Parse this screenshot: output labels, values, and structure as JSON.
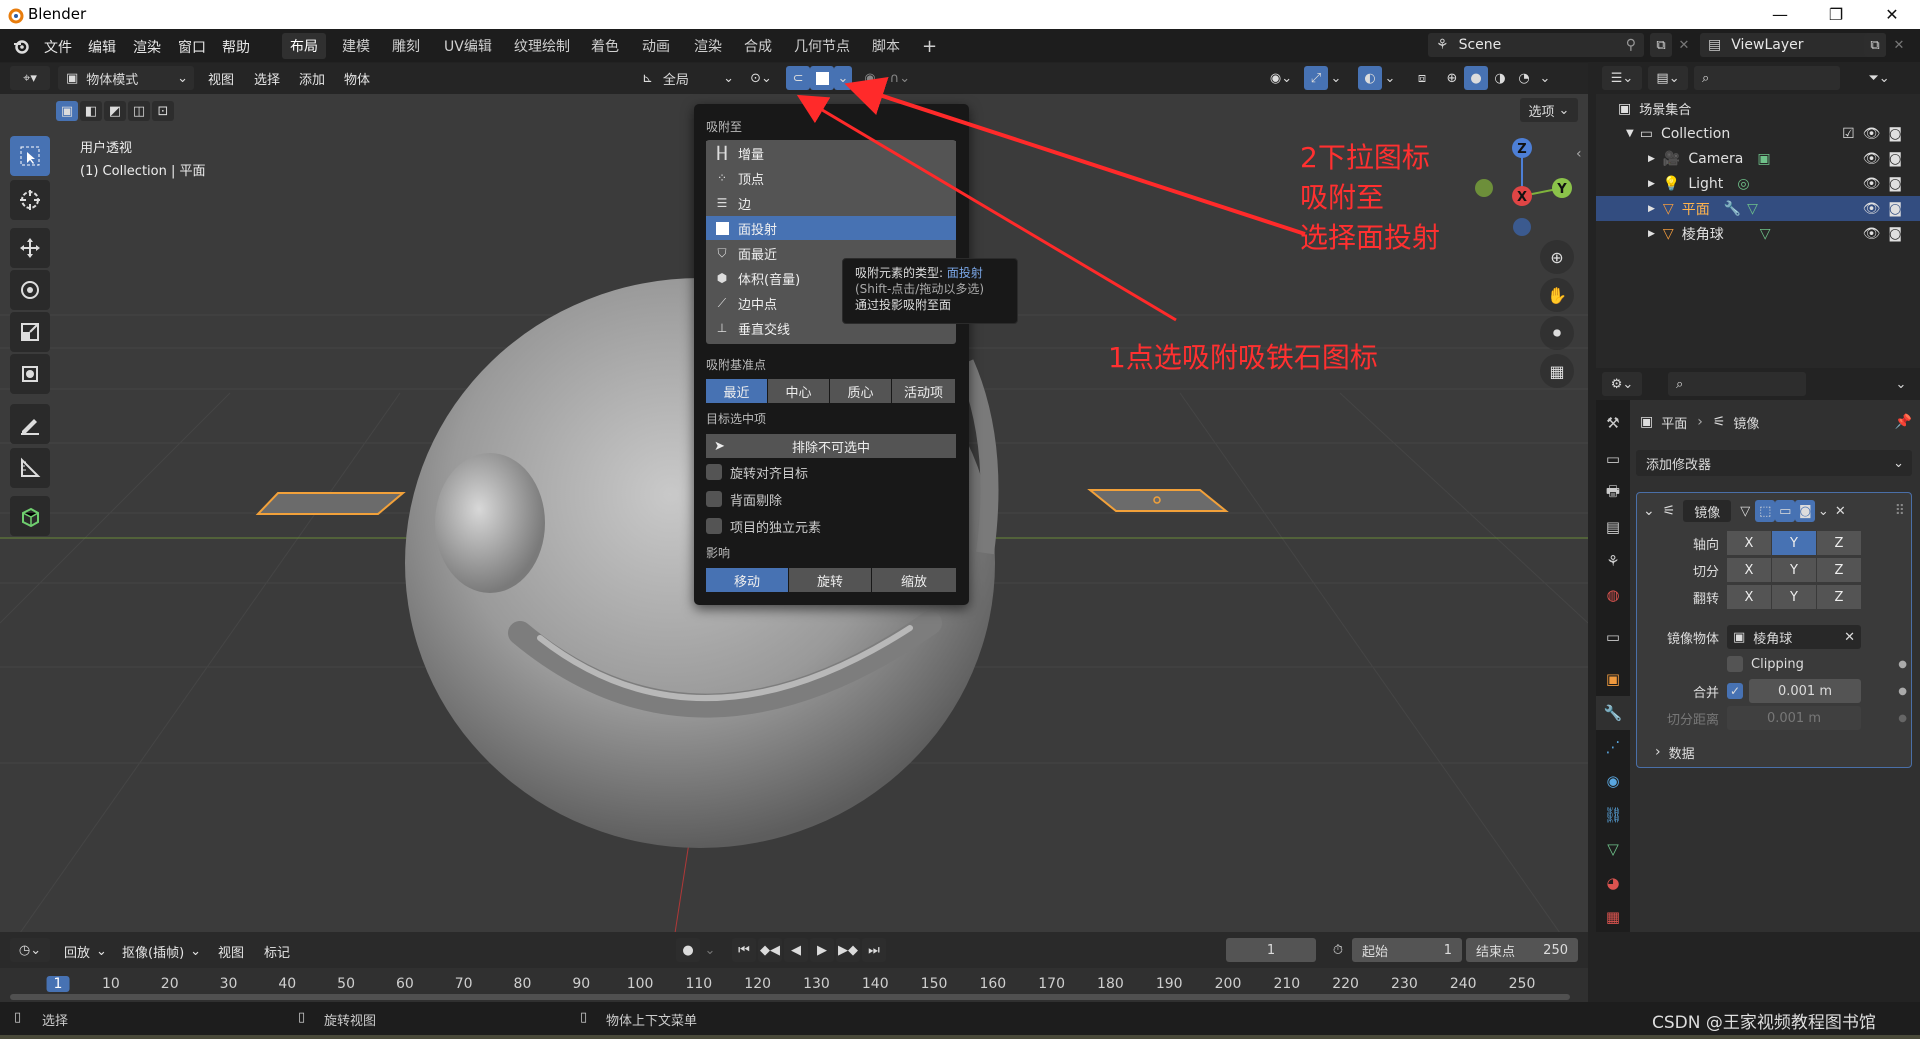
{
  "window": {
    "title": "Blender"
  },
  "menubar": {
    "menus": [
      "文件",
      "编辑",
      "渲染",
      "窗口",
      "帮助"
    ],
    "workspaces": [
      "布局",
      "建模",
      "雕刻",
      "UV编辑",
      "纹理绘制",
      "着色",
      "动画",
      "渲染",
      "合成",
      "几何节点",
      "脚本"
    ],
    "add_tab": "+",
    "scene": "Scene",
    "view_layer": "ViewLayer"
  },
  "viewport_header": {
    "mode": "物体模式",
    "menus": [
      "视图",
      "选择",
      "添加",
      "物体"
    ],
    "orientation": "全局",
    "options_label": "选项"
  },
  "viewport": {
    "view_name": "用户透视",
    "collection_info": "(1) Collection | 平面"
  },
  "snap_popup": {
    "snap_to_label": "吸附至",
    "snap_items": [
      {
        "label": "增量",
        "icon": "increment-icon"
      },
      {
        "label": "顶点",
        "icon": "vertex-icon"
      },
      {
        "label": "边",
        "icon": "edge-icon"
      },
      {
        "label": "面投射",
        "icon": "face-project-icon"
      },
      {
        "label": "面最近",
        "icon": "face-nearest-icon"
      },
      {
        "label": "体积(音量)",
        "icon": "volume-icon"
      },
      {
        "label": "边中点",
        "icon": "edge-center-icon"
      },
      {
        "label": "垂直交线",
        "icon": "perpendicular-icon"
      }
    ],
    "selected_item": "面投射",
    "base_label": "吸附基准点",
    "base_options": [
      "最近",
      "中心",
      "质心",
      "活动项"
    ],
    "base_selected": "最近",
    "target_label": "目标选中项",
    "exclude_button": "排除不可选中",
    "checkboxes": [
      "旋转对齐目标",
      "背面剔除",
      "项目的独立元素"
    ],
    "affect_label": "影响",
    "affect_options": [
      "移动",
      "旋转",
      "缩放"
    ],
    "affect_selected": "移动"
  },
  "tooltip": {
    "line1_prefix": "吸附元素的类型:",
    "line1_value": "面投射",
    "line2": "(Shift-点击/拖动以多选)",
    "line3": "通过投影吸附至面"
  },
  "annotations": {
    "step2_line1": "2下拉图标",
    "step2_line2": "吸附至",
    "step2_line3": "选择面投射",
    "step1": "1点选吸附吸铁石图标"
  },
  "gizmo": {
    "z": "Z",
    "y": "Y",
    "x": "X"
  },
  "outliner": {
    "scene_collection": "场景集合",
    "items": [
      {
        "name": "Collection",
        "level": 0
      },
      {
        "name": "Camera",
        "level": 1
      },
      {
        "name": "Light",
        "level": 1
      },
      {
        "name": "平面",
        "level": 1,
        "selected": true
      },
      {
        "name": "棱角球",
        "level": 1
      }
    ]
  },
  "properties": {
    "breadcrumb_object": "平面",
    "breadcrumb_modifier": "镜像",
    "add_modifier": "添加修改器",
    "modifier_name": "镜像",
    "axis_label": "轴向",
    "bisect_label": "切分",
    "flip_label": "翻转",
    "axes": [
      "X",
      "Y",
      "Z"
    ],
    "axis_selected": "Y",
    "mirror_object_label": "镜像物体",
    "mirror_object_value": "棱角球",
    "clipping_label": "Clipping",
    "merge_label": "合并",
    "merge_value": "0.001 m",
    "bisect_distance_label": "切分距离",
    "bisect_distance_value": "0.001 m",
    "data_label": "数据"
  },
  "timeline": {
    "playback": "回放",
    "keying": "抠像(插帧)",
    "view": "视图",
    "marker": "标记",
    "current_frame": "1",
    "start_label": "起始",
    "start_value": "1",
    "end_label": "结束点",
    "end_value": "250",
    "ticks": [
      "1",
      "10",
      "20",
      "30",
      "40",
      "50",
      "60",
      "70",
      "80",
      "90",
      "100",
      "110",
      "120",
      "130",
      "140",
      "150",
      "160",
      "170",
      "180",
      "190",
      "200",
      "210",
      "220",
      "230",
      "240",
      "250"
    ]
  },
  "statusbar": {
    "select": "选择",
    "rotate_view": "旋转视图",
    "context_menu": "物体上下文菜单",
    "watermark": "CSDN @王家视频教程图书馆"
  },
  "colors": {
    "accent": "#4772b3",
    "annotation": "#ff3030",
    "selection_outline": "#f2a13a"
  }
}
